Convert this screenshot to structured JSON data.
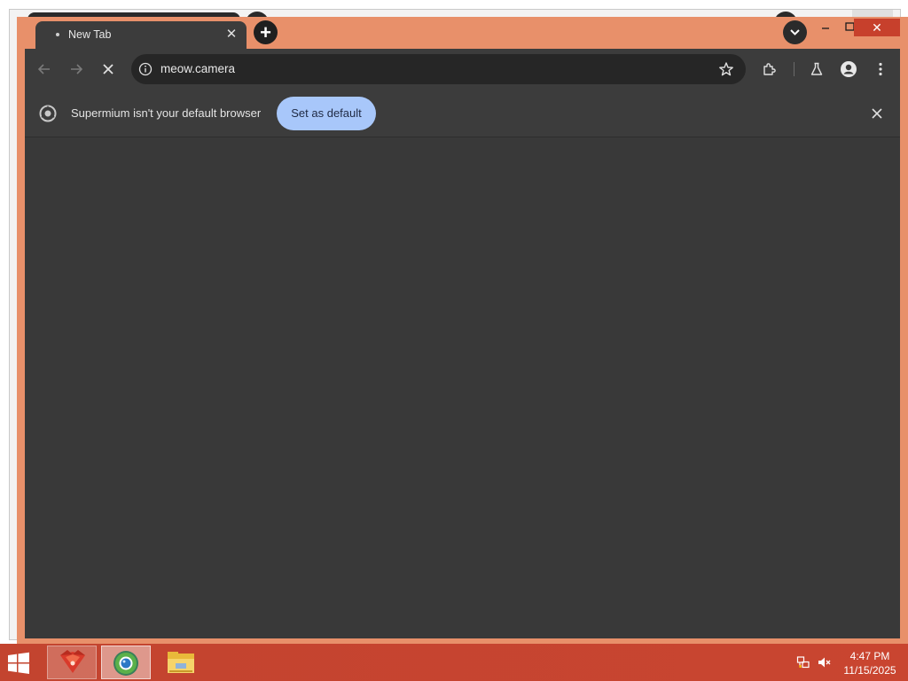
{
  "browser": {
    "tab": {
      "title": "New Tab",
      "close_glyph": "✕"
    },
    "new_tab_glyph": "+",
    "window_close_glyph": "✕",
    "address_bar": {
      "url": "meow.camera"
    },
    "infobar": {
      "message": "Supermium isn't your default browser",
      "button_label": "Set as default"
    }
  },
  "taskbar": {
    "apps": [
      {
        "name": "app-icon-red"
      },
      {
        "name": "supermium-browser-icon"
      },
      {
        "name": "file-explorer-icon"
      }
    ],
    "clock": {
      "time": "4:47 PM",
      "date": "11/15/2025"
    }
  },
  "colors": {
    "window_border": "#e8906a",
    "taskbar": "#c3442f",
    "chrome_dark": "#3c3c3c",
    "content": "#393939",
    "accent_button": "#a8c7fa",
    "close_red": "#c7402c"
  }
}
